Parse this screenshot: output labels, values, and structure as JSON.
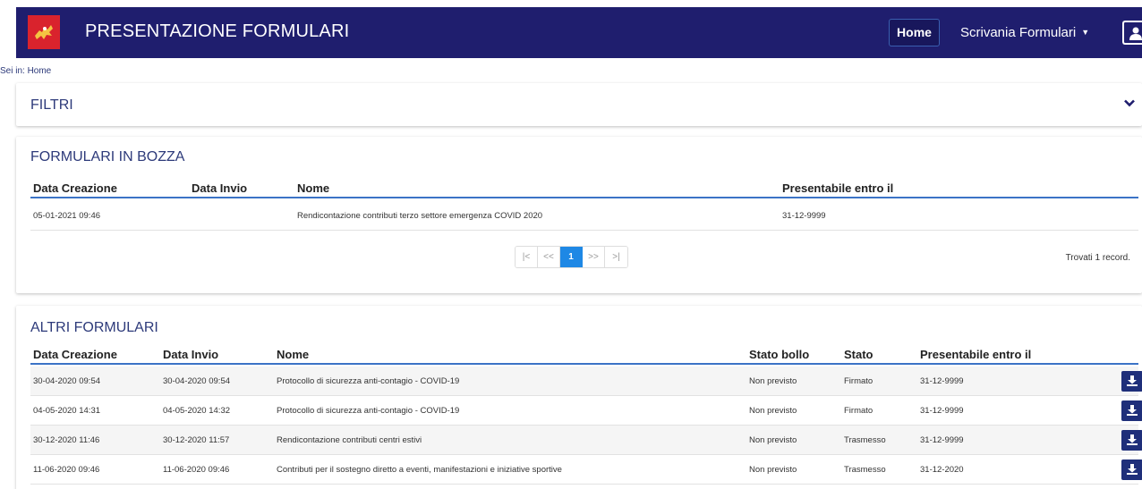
{
  "header": {
    "app_title": "PRESENTAZIONE FORMULARI",
    "nav_home": "Home",
    "nav_desk": "Scrivania Formulari",
    "caret": "▼"
  },
  "breadcrumb": "Sei in: Home",
  "filtri": {
    "title": "FILTRI"
  },
  "bozza": {
    "title": "FORMULARI IN BOZZA",
    "columns": [
      "Data Creazione",
      "Data Invio",
      "Nome",
      "Presentabile entro il"
    ],
    "rows": [
      {
        "creazione": "05-01-2021 09:46",
        "invio": "",
        "nome": "Rendicontazione contributi terzo settore emergenza COVID 2020",
        "entro": "31-12-9999"
      }
    ],
    "pager": [
      "|<",
      "<<",
      "1",
      ">>",
      ">|"
    ],
    "found": "Trovati 1 record."
  },
  "altri": {
    "title": "ALTRI FORMULARI",
    "columns": [
      "Data Creazione",
      "Data Invio",
      "Nome",
      "Stato bollo",
      "Stato",
      "Presentabile entro il"
    ],
    "rows": [
      {
        "creazione": "30-04-2020 09:54",
        "invio": "30-04-2020 09:54",
        "nome": "Protocollo di sicurezza anti-contagio - COVID-19",
        "bollo": "Non previsto",
        "stato": "Firmato",
        "entro": "31-12-9999"
      },
      {
        "creazione": "04-05-2020 14:31",
        "invio": "04-05-2020 14:32",
        "nome": "Protocollo di sicurezza anti-contagio - COVID-19",
        "bollo": "Non previsto",
        "stato": "Firmato",
        "entro": "31-12-9999"
      },
      {
        "creazione": "30-12-2020 11:46",
        "invio": "30-12-2020 11:57",
        "nome": "Rendicontazione contributi centri estivi",
        "bollo": "Non previsto",
        "stato": "Trasmesso",
        "entro": "31-12-9999"
      },
      {
        "creazione": "11-06-2020 09:46",
        "invio": "11-06-2020 09:46",
        "nome": "Contributi per il sostegno diretto a eventi, manifestazioni e iniziative sportive",
        "bollo": "Non previsto",
        "stato": "Trasmesso",
        "entro": "31-12-2020"
      }
    ]
  },
  "icons": {
    "logo": "regione-toscana-logo-icon",
    "user": "user-icon",
    "chevron": "chevron-down-icon",
    "download": "download-icon"
  },
  "colors": {
    "header_bg": "#1f1e6e",
    "accent_blue": "#3b73c6",
    "pager_active": "#1e88e5",
    "button_bg": "#1f2f7a"
  }
}
